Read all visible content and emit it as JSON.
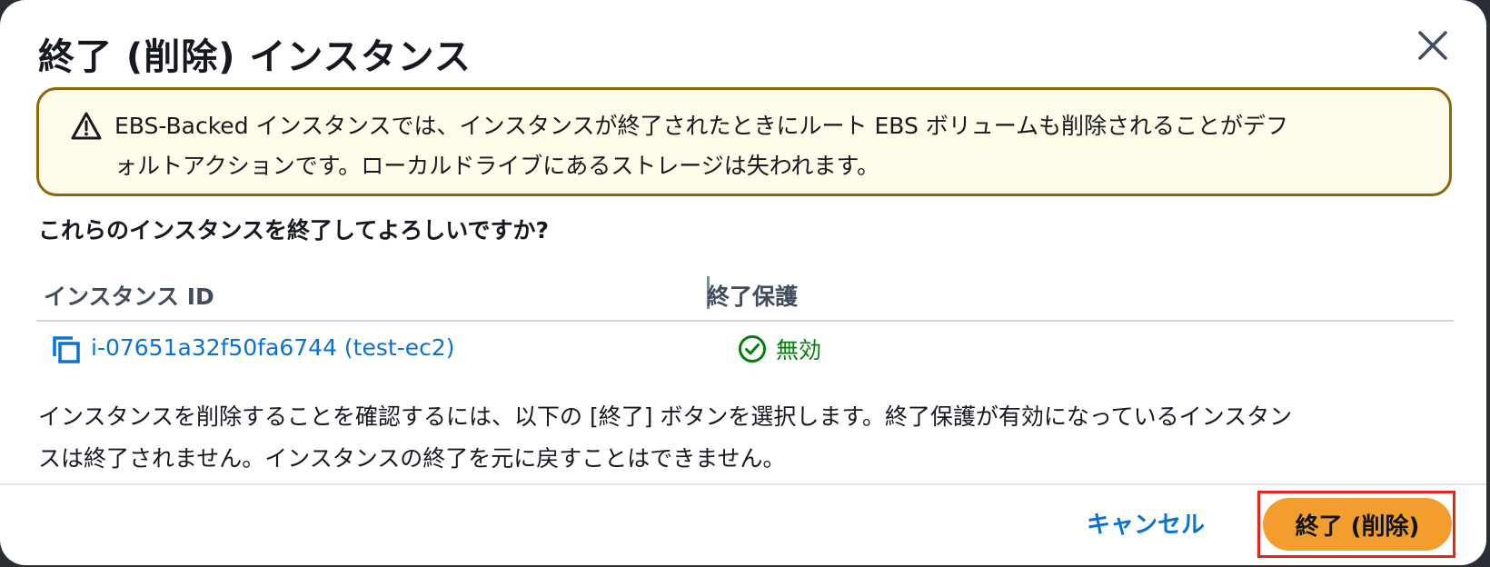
{
  "dialog": {
    "title": "終了 (削除) インスタンス",
    "close_icon": "close-icon"
  },
  "alert": {
    "icon": "warning-icon",
    "line1": "EBS-Backed インスタンスでは、インスタンスが終了されたときにルート EBS ボリュームも削除されることがデフ",
    "line2": "ォルトアクションです。ローカルドライブにあるストレージは失われます。"
  },
  "question": "これらのインスタンスを終了してよろしいですか?",
  "table": {
    "columns": [
      "インスタンス ID",
      "終了保護"
    ],
    "rows": [
      {
        "instance": "i-07651a32f50fa6744 (test-ec2)",
        "protection": "無効",
        "protection_icon": "check-circle-icon"
      }
    ]
  },
  "confirm": {
    "line1": "インスタンスを削除することを確認するには、以下の [終了] ボタンを選択します。終了保護が有効になっているインスタン",
    "line2": "スは終了されません。インスタンスの終了を元に戻すことはできません。"
  },
  "footer": {
    "cancel_label": "キャンセル",
    "terminate_label": "終了 (削除)"
  },
  "colors": {
    "link": "#0972d3",
    "success": "#037f0c",
    "warning_border": "#8d6605",
    "warning_bg": "#fffce9",
    "primary_button": "#f39d2f",
    "highlight_outline": "#e3261c"
  }
}
